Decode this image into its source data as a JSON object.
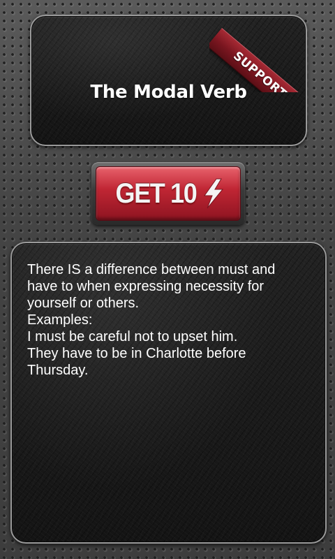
{
  "header": {
    "title": "The Modal Verb",
    "support_label": "SUPPORT"
  },
  "action": {
    "label": "GET 10",
    "icon": "lightning-bolt-icon"
  },
  "content": {
    "text": "There IS a difference between must and have to when expressing necessity for yourself or others.\nExamples:\nI must be careful not to upset him.\nThey have to be in Charlotte before Thursday."
  },
  "colors": {
    "button_red": "#c02634",
    "ribbon_red": "#7a1620",
    "text": "#ffffff",
    "panel_bg": "#161616"
  }
}
